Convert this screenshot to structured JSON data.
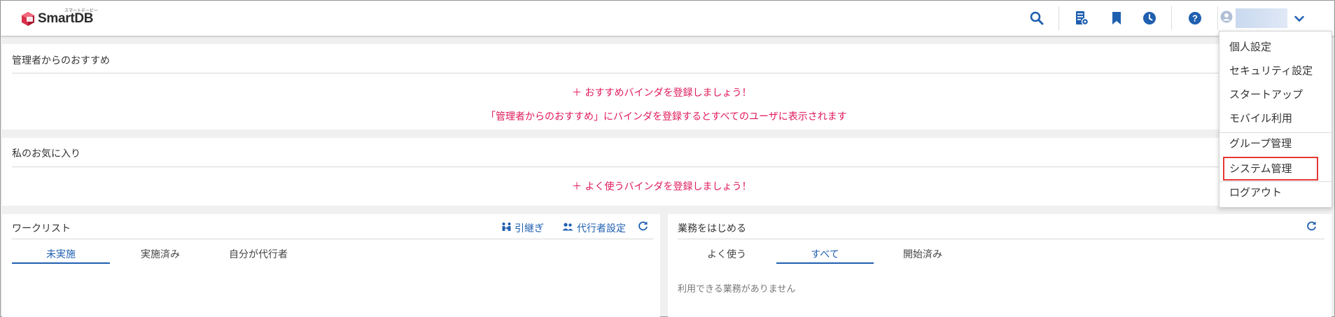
{
  "header": {
    "logo_text": "SmartDB",
    "logo_sub": "スマートデービー",
    "icons": [
      "search-icon",
      "document-settings-icon",
      "bookmark-icon",
      "history-clock-icon",
      "help-icon",
      "user-avatar-icon",
      "chevron-down-icon"
    ]
  },
  "recommend": {
    "title": "管理者からのおすすめ",
    "add_link": "＋ おすすめバインダを登録しましょう！",
    "message": "「管理者からのおすすめ」にバインダを登録するとすべてのユーザに表示されます"
  },
  "favorites": {
    "title": "私のお気に入り",
    "add_link": "＋ よく使うバインダを登録しましょう！"
  },
  "worklist": {
    "title": "ワークリスト",
    "handover_label": "引継ぎ",
    "proxy_label": "代行者設定",
    "tabs": [
      "未実施",
      "実施済み",
      "自分が代行者"
    ],
    "active_tab": 0
  },
  "start_work": {
    "title": "業務をはじめる",
    "tabs": [
      "よく使う",
      "すべて",
      "開始済み"
    ],
    "active_tab": 1,
    "empty_message": "利用できる業務がありません"
  },
  "user_menu": {
    "items": [
      "個人設定",
      "セキュリティ設定",
      "スタートアップ",
      "モバイル利用",
      "グループ管理",
      "システム管理",
      "ログアウト"
    ],
    "highlighted": "システム管理"
  },
  "colors": {
    "accent_blue": "#1f5fb0",
    "pink": "#e0195a",
    "highlight_red": "#e53935",
    "logo_red": "#d9304a"
  }
}
